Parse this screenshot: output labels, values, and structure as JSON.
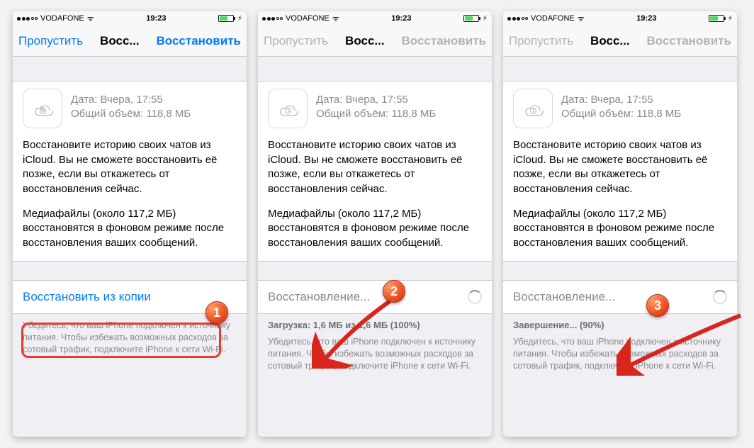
{
  "status": {
    "carrier": "VODAFONE",
    "time": "19:23",
    "wifi_glyph": "⋮"
  },
  "nav": {
    "skip": "Пропустить",
    "title": "Восс...",
    "restore": "Восстановить"
  },
  "info": {
    "date_label": "Дата: Вчера, 17:55",
    "size_label": "Общий объём: 118,8 МБ",
    "para1": "Восстановите историю своих чатов из iCloud. Вы не сможете восстановить её позже, если вы откажетесь от восстановления сейчас.",
    "para2": "Медиафайлы (около 117,2 МБ) восстановятся в фоновом режиме после восстановления ваших сообщений."
  },
  "screens": [
    {
      "action_label": "Восстановить из копии",
      "footer": "Убедитесь, что ваш iPhone подключен к источнику питания. Чтобы избежать возможных расходов за сотовый трафик, подключите iPhone к сети Wi-Fi."
    },
    {
      "action_label": "Восстановление...",
      "download_prefix": "Загрузка:",
      "download_value": "1,6 МБ из 1,6 МБ (100%)",
      "footer": "Убедитесь, что ваш iPhone подключен к источнику питания. Чтобы избежать возможных расходов за сотовый трафик, подключите iPhone к сети Wi-Fi."
    },
    {
      "action_label": "Восстановление...",
      "complete_label": "Завершение... (90%)",
      "footer": "Убедитесь, что ваш iPhone подключен к источнику питания. Чтобы избежать возможных расходов за сотовый трафик, подключите iPhone к сети Wi-Fi."
    }
  ],
  "badges": [
    "1",
    "2",
    "3"
  ]
}
